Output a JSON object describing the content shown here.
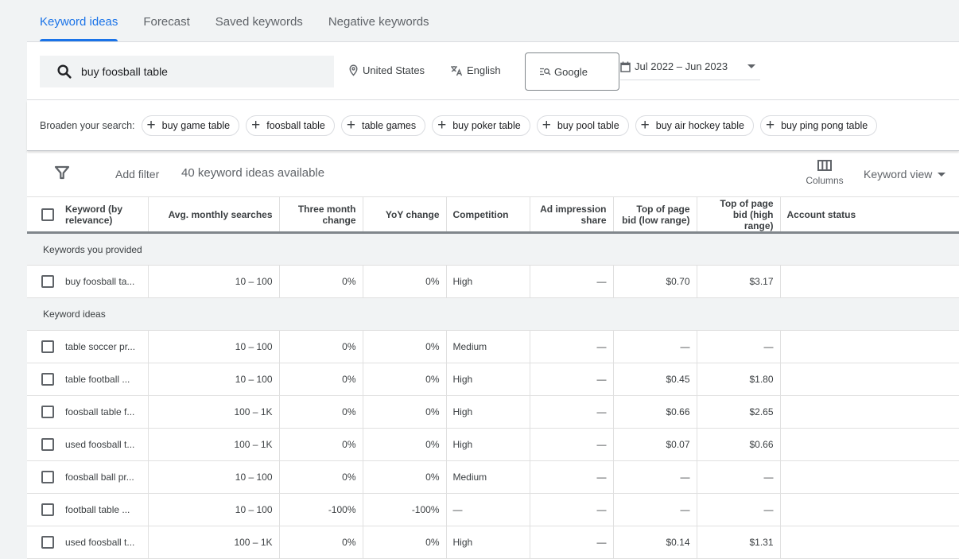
{
  "tabs": [
    {
      "label": "Keyword ideas",
      "active": true
    },
    {
      "label": "Forecast",
      "active": false
    },
    {
      "label": "Saved keywords",
      "active": false
    },
    {
      "label": "Negative keywords",
      "active": false
    }
  ],
  "search": {
    "value": "buy foosball table",
    "icon": "search-icon"
  },
  "location": {
    "label": "United States",
    "icon": "location-pin-icon"
  },
  "language": {
    "label": "English",
    "icon": "translate-icon"
  },
  "network": {
    "label": "Google",
    "icon": "search-network-icon"
  },
  "date_range": {
    "label": "Jul 2022 – Jun 2023",
    "icon": "calendar-icon"
  },
  "broaden": {
    "label": "Broaden your search:",
    "chips": [
      "buy game table",
      "foosball table",
      "table games",
      "buy poker table",
      "buy pool table",
      "buy air hockey table",
      "buy ping pong table"
    ]
  },
  "toolbar": {
    "add_filter": "Add filter",
    "count_text": "40 keyword ideas available",
    "columns_label": "Columns",
    "view_label": "Keyword view"
  },
  "table": {
    "columns": [
      "Keyword (by relevance)",
      "Avg. monthly searches",
      "Three month change",
      "YoY change",
      "Competition",
      "Ad impression share",
      "Top of page bid (low range)",
      "Top of page bid (high range)",
      "Account status"
    ],
    "groups": [
      {
        "title": "Keywords you provided",
        "rows": [
          {
            "keyword": "buy foosball ta...",
            "searches": "10 – 100",
            "three_month": "0%",
            "yoy": "0%",
            "competition": "High",
            "impression_share": "—",
            "bid_low": "$0.70",
            "bid_high": "$3.17",
            "status": ""
          }
        ]
      },
      {
        "title": "Keyword ideas",
        "rows": [
          {
            "keyword": "table soccer pr...",
            "searches": "10 – 100",
            "three_month": "0%",
            "yoy": "0%",
            "competition": "Medium",
            "impression_share": "—",
            "bid_low": "—",
            "bid_high": "—",
            "status": ""
          },
          {
            "keyword": "table football ...",
            "searches": "10 – 100",
            "three_month": "0%",
            "yoy": "0%",
            "competition": "High",
            "impression_share": "—",
            "bid_low": "$0.45",
            "bid_high": "$1.80",
            "status": ""
          },
          {
            "keyword": "foosball table f...",
            "searches": "100 – 1K",
            "three_month": "0%",
            "yoy": "0%",
            "competition": "High",
            "impression_share": "—",
            "bid_low": "$0.66",
            "bid_high": "$2.65",
            "status": ""
          },
          {
            "keyword": "used foosball t...",
            "searches": "100 – 1K",
            "three_month": "0%",
            "yoy": "0%",
            "competition": "High",
            "impression_share": "—",
            "bid_low": "$0.07",
            "bid_high": "$0.66",
            "status": ""
          },
          {
            "keyword": "foosball ball pr...",
            "searches": "10 – 100",
            "three_month": "0%",
            "yoy": "0%",
            "competition": "Medium",
            "impression_share": "—",
            "bid_low": "—",
            "bid_high": "—",
            "status": ""
          },
          {
            "keyword": "football table ...",
            "searches": "10 – 100",
            "three_month": "-100%",
            "yoy": "-100%",
            "competition": "—",
            "impression_share": "—",
            "bid_low": "—",
            "bid_high": "—",
            "status": ""
          },
          {
            "keyword": "used foosball t...",
            "searches": "100 – 1K",
            "three_month": "0%",
            "yoy": "0%",
            "competition": "High",
            "impression_share": "—",
            "bid_low": "$0.14",
            "bid_high": "$1.31",
            "status": ""
          }
        ]
      }
    ]
  },
  "colors": {
    "accent": "#1a73e8",
    "background": "#f1f3f4",
    "text": "#3c4043"
  }
}
